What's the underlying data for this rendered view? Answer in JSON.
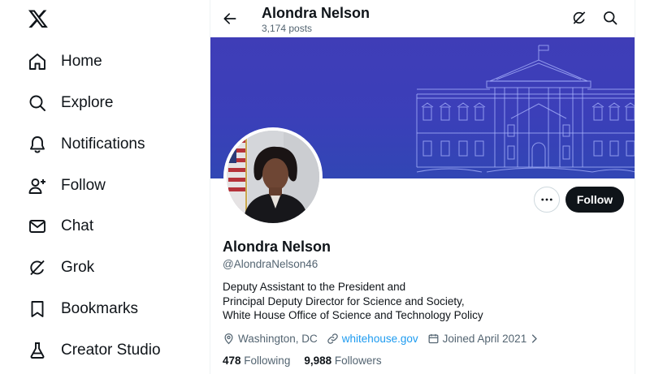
{
  "sidebar": {
    "logo": "x-logo",
    "items": [
      {
        "label": "Home",
        "icon": "home-icon"
      },
      {
        "label": "Explore",
        "icon": "search-icon"
      },
      {
        "label": "Notifications",
        "icon": "bell-icon"
      },
      {
        "label": "Follow",
        "icon": "person-plus-icon"
      },
      {
        "label": "Chat",
        "icon": "envelope-icon"
      },
      {
        "label": "Grok",
        "icon": "grok-icon"
      },
      {
        "label": "Bookmarks",
        "icon": "bookmark-icon"
      },
      {
        "label": "Creator Studio",
        "icon": "flask-icon"
      }
    ]
  },
  "header": {
    "name": "Alondra Nelson",
    "posts": "3,174 posts"
  },
  "profile": {
    "name": "Alondra Nelson",
    "handle": "@AlondraNelson46",
    "follow_label": "Follow",
    "bio_lines": [
      "Deputy Assistant to the President and",
      "Principal Deputy Director for Science and Society,",
      "White House Office of Science and Technology Policy"
    ],
    "location": "Washington, DC",
    "website": "whitehouse.gov",
    "joined": "Joined April 2021",
    "following_count": "478",
    "following_label": "Following",
    "followers_count": "9,988",
    "followers_label": "Followers"
  },
  "colors": {
    "banner": "#3b40b8",
    "follow_button": "#0f1419",
    "link": "#1d9bf0",
    "secondary_text": "#536471"
  }
}
